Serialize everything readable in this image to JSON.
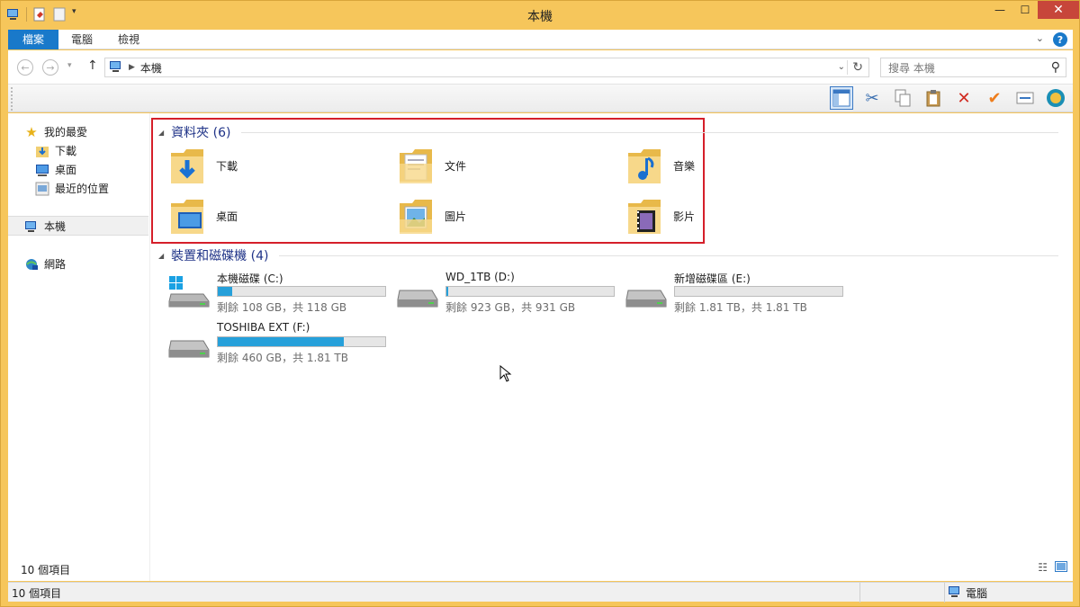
{
  "window": {
    "title": "本機"
  },
  "ribbon": {
    "tabs": [
      "檔案",
      "電腦",
      "檢視"
    ]
  },
  "address": {
    "location": "本機",
    "search_placeholder": "搜尋 本機"
  },
  "sidebar": {
    "favorites": "我的最愛",
    "fav_items": [
      "下載",
      "桌面",
      "最近的位置"
    ],
    "this_pc": "本機",
    "network": "網路"
  },
  "folders_group": {
    "header": "資料夾 (6)",
    "items": [
      "下載",
      "文件",
      "音樂",
      "桌面",
      "圖片",
      "影片"
    ]
  },
  "drives_group": {
    "header": "裝置和磁碟機 (4)",
    "drives": [
      {
        "name": "本機磁碟 (C:)",
        "free": "剩餘 108 GB，共 118 GB",
        "used_fraction": 0.085
      },
      {
        "name": "WD_1TB (D:)",
        "free": "剩餘 923 GB，共 931 GB",
        "used_fraction": 0.009
      },
      {
        "name": "新增磁碟區 (E:)",
        "free": "剩餘 1.81 TB，共 1.81 TB",
        "used_fraction": 0.0
      },
      {
        "name": "TOSHIBA EXT (F:)",
        "free": "剩餘 460 GB，共 1.81 TB",
        "used_fraction": 0.75
      }
    ]
  },
  "status": {
    "count": "10 個項目",
    "bottom_count": "10 個項目",
    "computer": "電腦"
  },
  "colors": {
    "accent": "#1979ca",
    "frame": "#f6c65b",
    "highlight_border": "#d51f2a",
    "bar_fill": "#26a0da"
  }
}
